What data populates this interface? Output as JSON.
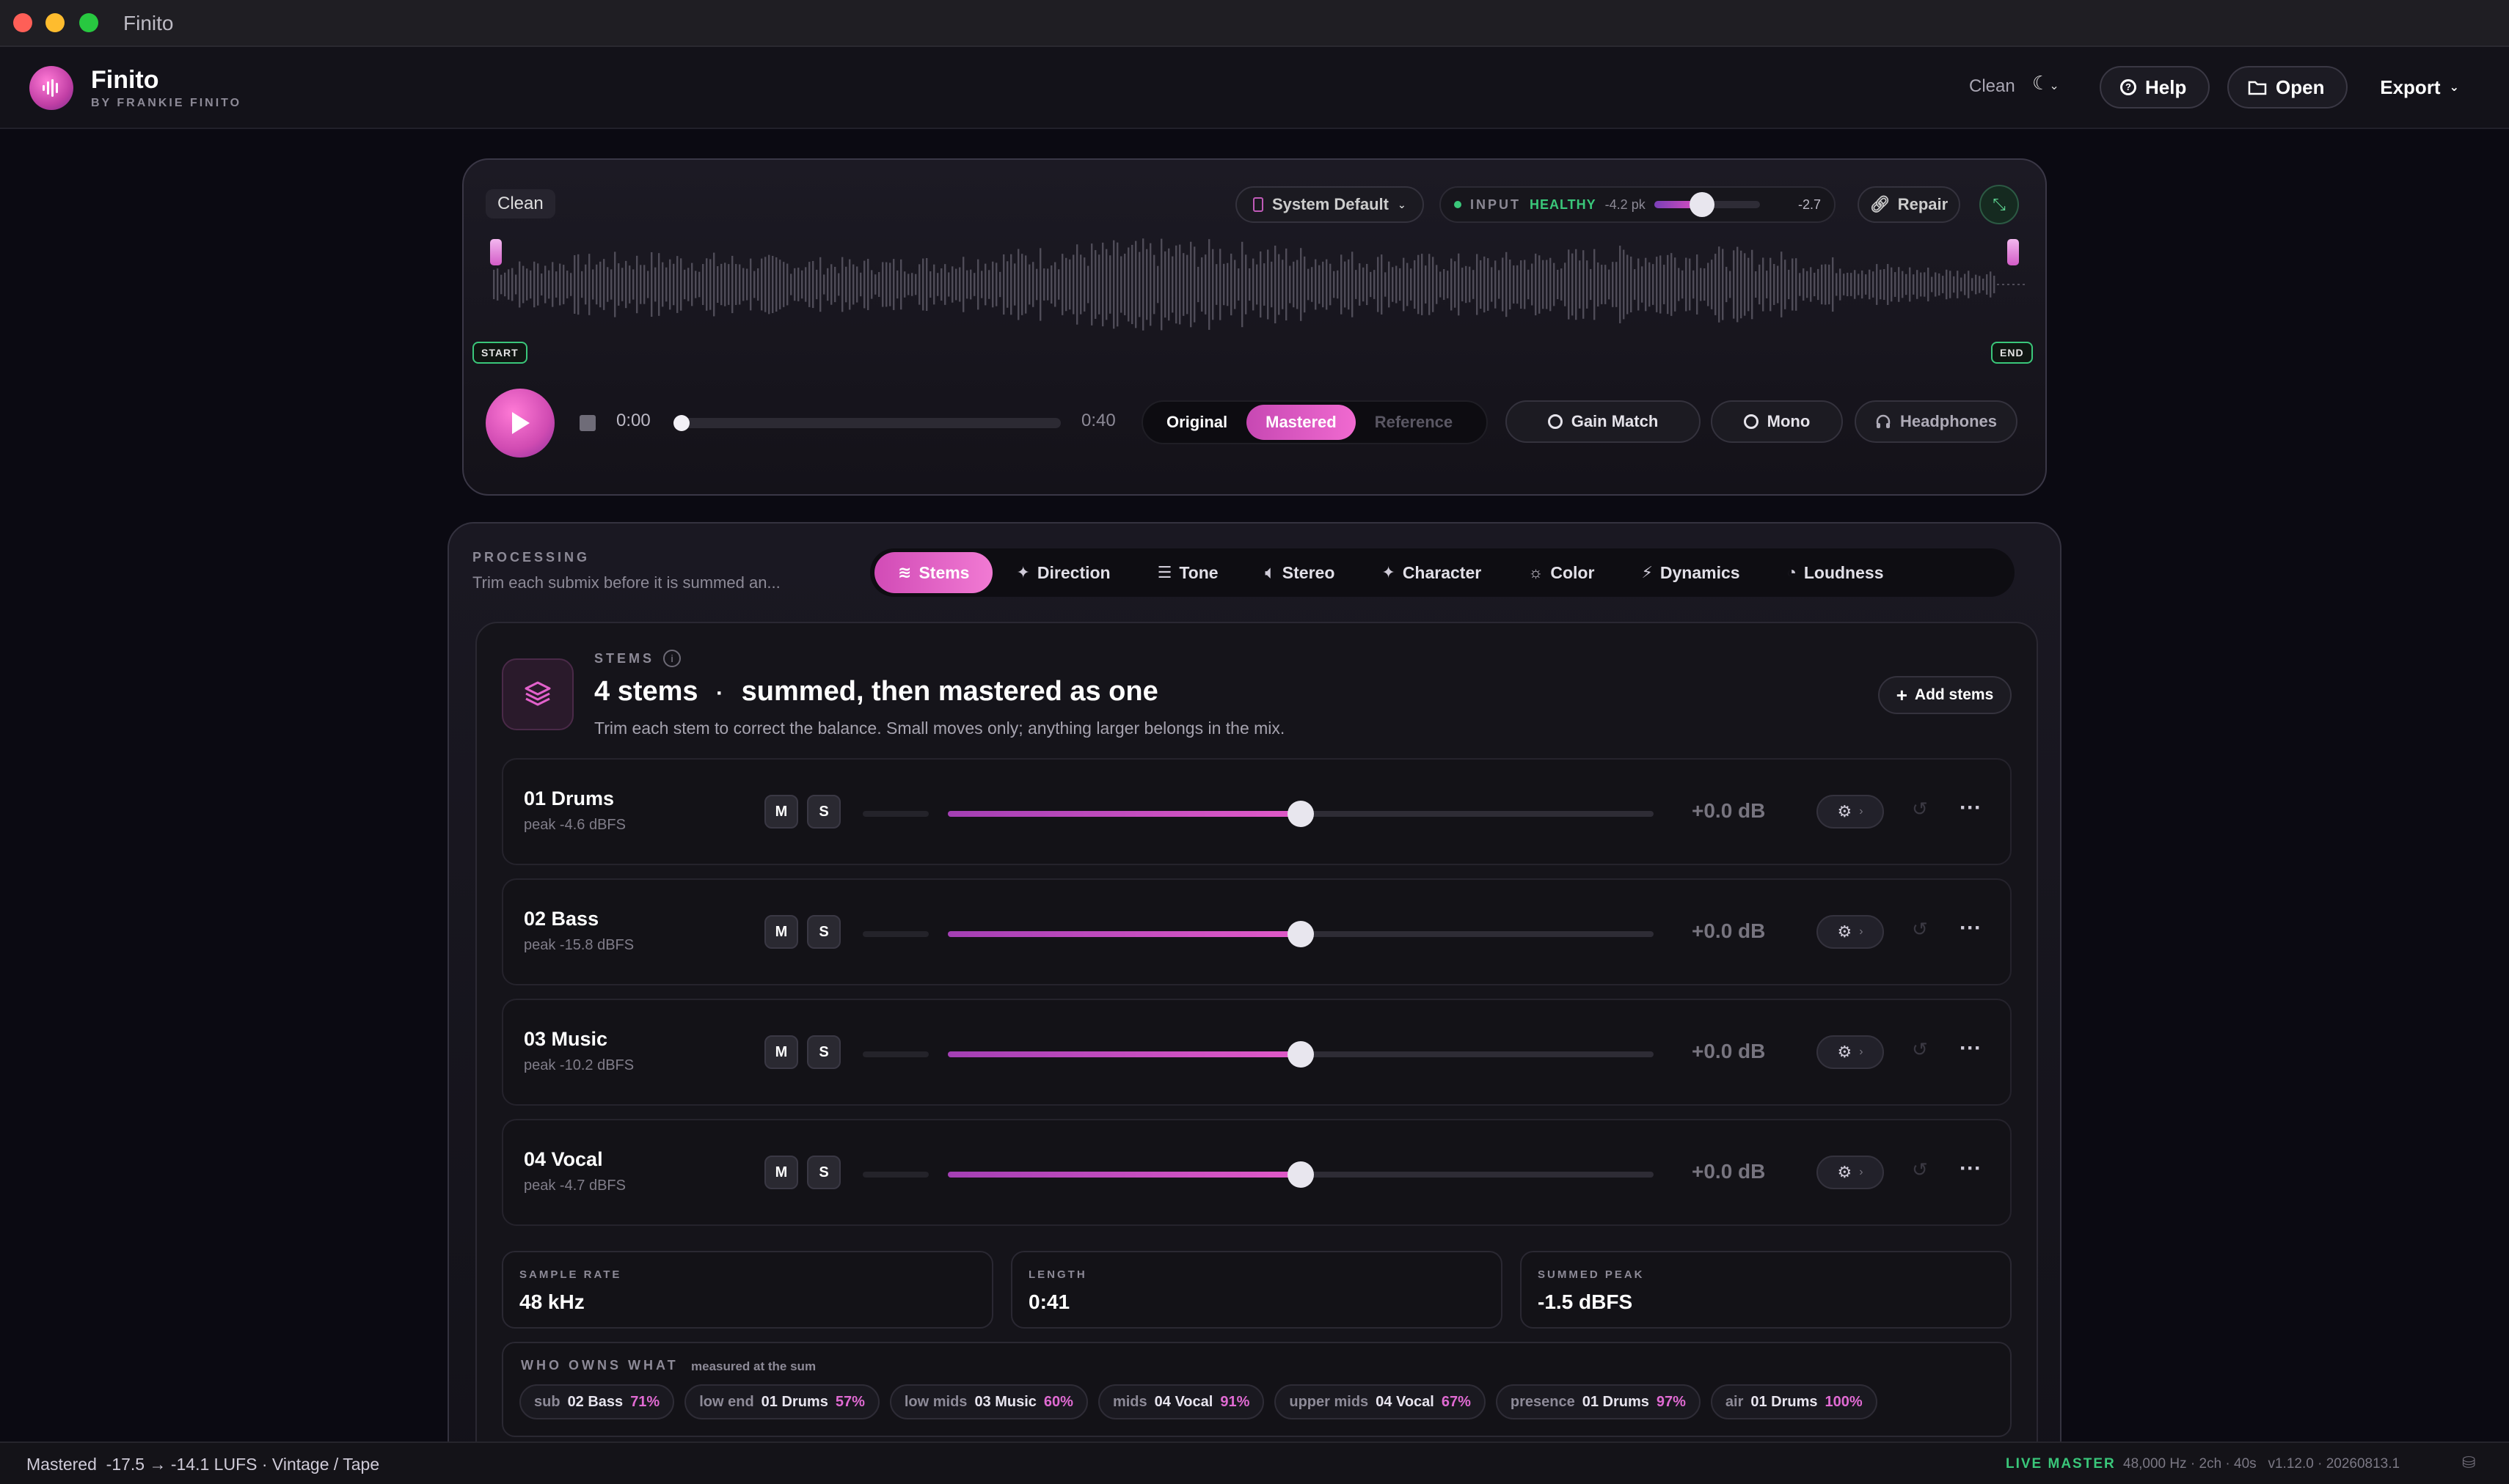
{
  "window": {
    "title": "Finito"
  },
  "header": {
    "brand": "Finito",
    "brand_sub": "BY FRANKIE FINITO",
    "preset": "Clean",
    "help": "Help",
    "open": "Open",
    "export": "Export"
  },
  "player": {
    "preset_chip": "Clean",
    "output_device": "System Default",
    "input": {
      "label": "INPUT",
      "status": "HEALTHY",
      "peak": "-4.2 pk",
      "value": "-2.7",
      "level": 0.45
    },
    "repair": "Repair",
    "start_tag": "START",
    "end_tag": "END",
    "time_current": "0:00",
    "time_end": "0:40",
    "compare": {
      "original": "Original",
      "mastered": "Mastered",
      "reference": "Reference"
    },
    "gain_match": "Gain Match",
    "mono": "Mono",
    "headphones": "Headphones"
  },
  "processing": {
    "label": "PROCESSING",
    "description": "Trim each submix before it is summed an...",
    "tabs": [
      {
        "label": "Stems",
        "icon": "layers-icon",
        "active": true
      },
      {
        "label": "Direction",
        "icon": "sparkle-icon",
        "active": false
      },
      {
        "label": "Tone",
        "icon": "sliders-icon",
        "active": false
      },
      {
        "label": "Stereo",
        "icon": "speaker-icon",
        "active": false
      },
      {
        "label": "Character",
        "icon": "sparkle-icon",
        "active": false
      },
      {
        "label": "Color",
        "icon": "sun-icon",
        "active": false
      },
      {
        "label": "Dynamics",
        "icon": "pulse-icon",
        "active": false
      },
      {
        "label": "Loudness",
        "icon": "gauge-icon",
        "active": false
      }
    ]
  },
  "stems": {
    "kicker": "STEMS",
    "title_count": "4 stems",
    "title_sep": "·",
    "title_rest": "summed, then mastered as one",
    "subtitle": "Trim each stem to correct the balance. Small moves only; anything larger belongs in the mix.",
    "add_label": "Add stems",
    "mute_label": "M",
    "solo_label": "S",
    "rows": [
      {
        "name": "01 Drums",
        "peak": "peak -4.6 dBFS",
        "gain": "+0.0 dB",
        "trim": 0.5
      },
      {
        "name": "02 Bass",
        "peak": "peak -15.8 dBFS",
        "gain": "+0.0 dB",
        "trim": 0.5
      },
      {
        "name": "03 Music",
        "peak": "peak -10.2 dBFS",
        "gain": "+0.0 dB",
        "trim": 0.5
      },
      {
        "name": "04 Vocal",
        "peak": "peak -4.7 dBFS",
        "gain": "+0.0 dB",
        "trim": 0.5
      }
    ],
    "stats": [
      {
        "label": "SAMPLE RATE",
        "value": "48 kHz"
      },
      {
        "label": "LENGTH",
        "value": "0:41"
      },
      {
        "label": "SUMMED PEAK",
        "value": "-1.5 dBFS"
      }
    ],
    "owns": {
      "title": "WHO OWNS WHAT",
      "subtitle": "measured at the sum",
      "chips": [
        {
          "band": "sub",
          "stem": "02 Bass",
          "pct": "71%"
        },
        {
          "band": "low end",
          "stem": "01 Drums",
          "pct": "57%"
        },
        {
          "band": "low mids",
          "stem": "03 Music",
          "pct": "60%"
        },
        {
          "band": "mids",
          "stem": "04 Vocal",
          "pct": "91%"
        },
        {
          "band": "upper mids",
          "stem": "04 Vocal",
          "pct": "67%"
        },
        {
          "band": "presence",
          "stem": "01 Drums",
          "pct": "97%"
        },
        {
          "band": "air",
          "stem": "01 Drums",
          "pct": "100%"
        }
      ]
    }
  },
  "status": {
    "left": "Mastered  -17.5 → -14.1 LUFS · Vintage / Tape",
    "live": "LIVE MASTER",
    "right": "48,000 Hz · 2ch · 40s   v1.12.0 · 20260813.1"
  }
}
